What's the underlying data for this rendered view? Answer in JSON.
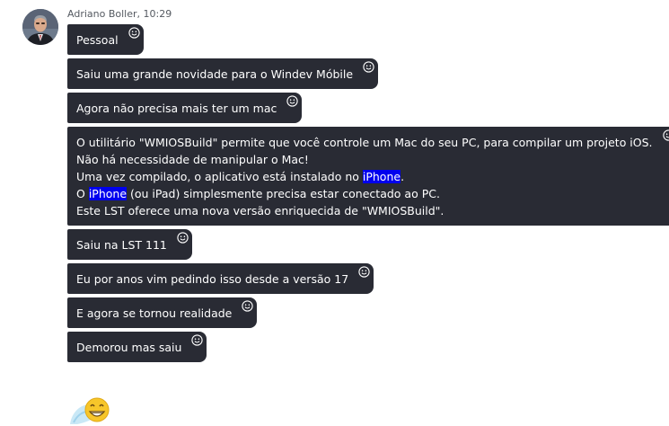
{
  "sender": {
    "name": "Adriano Boller",
    "time": "10:29",
    "separator": ", "
  },
  "messages": [
    {
      "lines": [
        "Pessoal"
      ]
    },
    {
      "lines": [
        "Saiu uma grande novidade para o Windev Móbile"
      ]
    },
    {
      "lines": [
        "Agora não precisa mais ter um mac"
      ]
    },
    {
      "lines": [
        "O utilitário \"WMIOSBuild\" permite que você controle um Mac do seu PC, para compilar um projeto iOS.",
        "Não há necessidade de manipular o Mac!",
        "Uma vez compilado, o aplicativo está instalado no ",
        "O ",
        "Este LST oferece uma nova versão enriquecida de \"WMIOSBuild\"."
      ],
      "highlight_word": "iPhone",
      "line3_suffix": ".",
      "line4_suffix": " (ou iPad) simplesmente precisa estar conectado ao PC."
    },
    {
      "lines": [
        "Saiu na LST 111"
      ]
    },
    {
      "lines": [
        "Eu por anos vim pedindo isso desde a versão 17"
      ]
    },
    {
      "lines": [
        "E agora se tornou realidade"
      ]
    },
    {
      "lines": [
        "Demorou mas saiu"
      ]
    }
  ],
  "colors": {
    "bubble_bg": "#292b34",
    "highlight_bg": "#0000ee",
    "meta_text": "#555a61"
  },
  "icons": {
    "reaction": "smiley-reaction-icon",
    "sticker": "grinning-emoji-sticker"
  }
}
